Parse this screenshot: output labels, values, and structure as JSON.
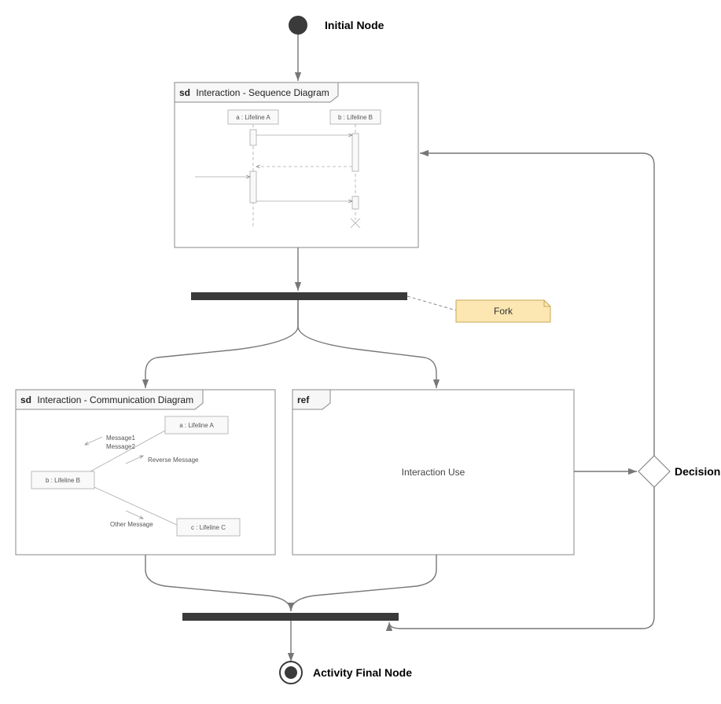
{
  "labels": {
    "initial": "Initial Node",
    "final": "Activity Final Node",
    "fork_note": "Fork",
    "decision": "Decision",
    "interaction_use": "Interaction Use"
  },
  "frames": {
    "seq": {
      "tag": "sd",
      "title": "Interaction - Sequence Diagram",
      "lifeline_a": "a : Lifeline A",
      "lifeline_b": "b : Lifeline B"
    },
    "comm": {
      "tag": "sd",
      "title": "Interaction - Communication Diagram",
      "lifeline_a": "a : Lifeline A",
      "lifeline_b": "b : Lifeline B",
      "lifeline_c": "c : Lifeline C",
      "msg1": "Message1",
      "msg2": "Message2",
      "reverse": "Reverse Message",
      "other": "Other Message"
    },
    "ref": {
      "tag": "ref"
    }
  }
}
